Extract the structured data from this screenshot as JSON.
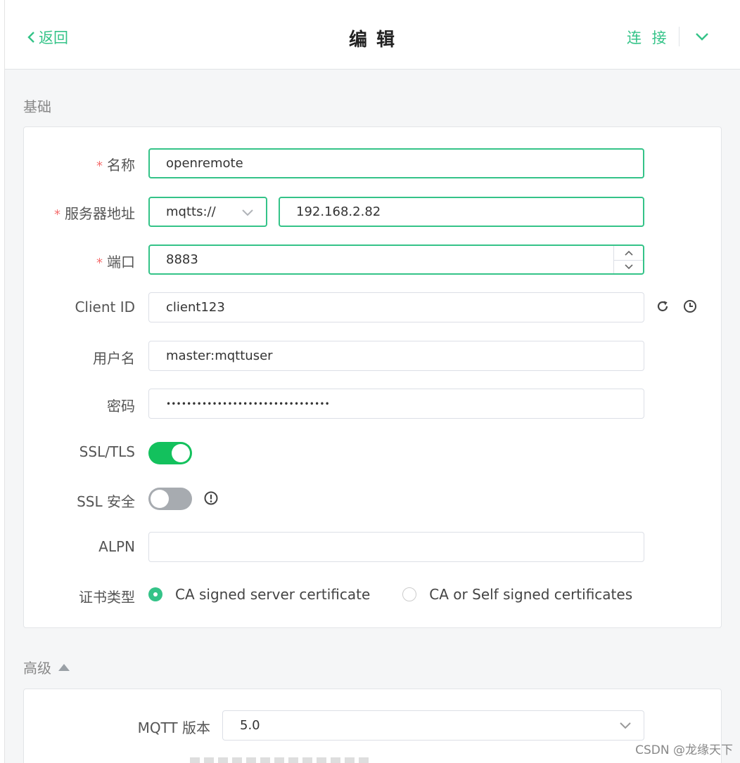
{
  "header": {
    "back_label": "返回",
    "title": "编 辑",
    "connect_label": "连 接"
  },
  "sections": {
    "basic_title": "基础",
    "advanced_title": "高级"
  },
  "form": {
    "name": {
      "label": "名称",
      "value": "openremote"
    },
    "host": {
      "label": "服务器地址",
      "protocol": "mqtts://",
      "value": "192.168.2.82"
    },
    "port": {
      "label": "端口",
      "value": "8883"
    },
    "client_id": {
      "label": "Client ID",
      "value": "client123"
    },
    "username": {
      "label": "用户名",
      "value": "master:mqttuser"
    },
    "password": {
      "label": "密码",
      "value": "••••••••••••••••••••••••••••••••"
    },
    "ssl_tls": {
      "label": "SSL/TLS",
      "enabled": true
    },
    "ssl_secure": {
      "label": "SSL 安全",
      "enabled": false
    },
    "alpn": {
      "label": "ALPN",
      "value": ""
    },
    "cert_type": {
      "label": "证书类型",
      "options": [
        "CA signed server certificate",
        "CA or Self signed certificates"
      ],
      "selected": "CA signed server certificate"
    }
  },
  "advanced": {
    "mqtt_version": {
      "label": "MQTT 版本",
      "value": "5.0"
    }
  },
  "watermark": "CSDN @龙缘天下",
  "colors": {
    "accent": "#34c388",
    "switch_on": "#13c15d",
    "required": "#f56c6c"
  }
}
